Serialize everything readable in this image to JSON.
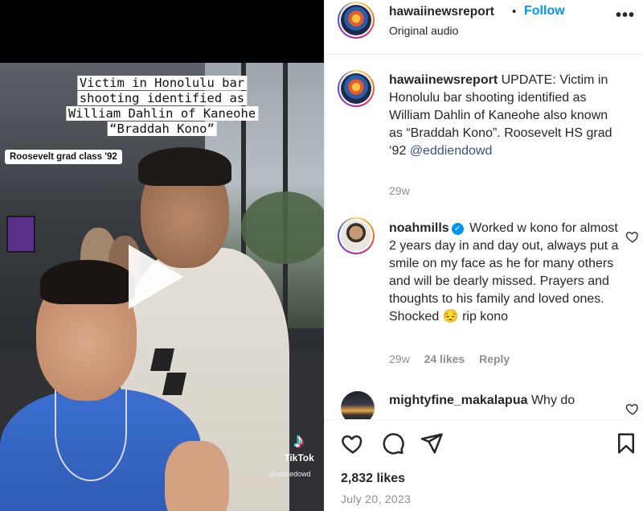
{
  "video": {
    "caption_lines": [
      "Victim in Honolulu bar",
      "shooting identified as",
      "William Dahlin of Kaneohe",
      "“Braddah Kono”"
    ],
    "grad_tag": "Roosevelt grad class '92",
    "watermark_brand": "TikTok",
    "watermark_handle": "@eddiedowd"
  },
  "header": {
    "username": "hawaiinewsreport",
    "separator": "•",
    "follow_label": "Follow",
    "audio_label": "Original audio",
    "more_label": "•••"
  },
  "comments": [
    {
      "username": "hawaiinewsreport",
      "text": "UPDATE: Victim in Honolulu bar shooting identified as",
      "text2": "William Dahlin of Kaneohe also known as “Braddah Kono”. Roosevelt HS grad ‘92",
      "mention": "@eddiendowd",
      "age": "29w"
    },
    {
      "username": "noahmills",
      "verified_mark": "✓",
      "text": "Worked w kono for almost 2 years day in and day out, always put a smile on my face as he for many others and will be dearly missed. Prayers and thoughts to his family and loved ones. Shocked 😔 rip kono",
      "age": "29w",
      "likes": "24 likes",
      "reply_label": "Reply"
    },
    {
      "username": "mightyfine_makalapua",
      "text": "Why do"
    }
  ],
  "footer": {
    "likes": "2,832 likes",
    "date": "July 20, 2023"
  },
  "icons": {
    "like": "heart-icon",
    "comment": "comment-icon",
    "share": "send-icon",
    "save": "bookmark-icon"
  },
  "colors": {
    "accent": "#0095f6",
    "text": "#262626",
    "muted": "#8e8e8e",
    "mention": "#385185"
  }
}
